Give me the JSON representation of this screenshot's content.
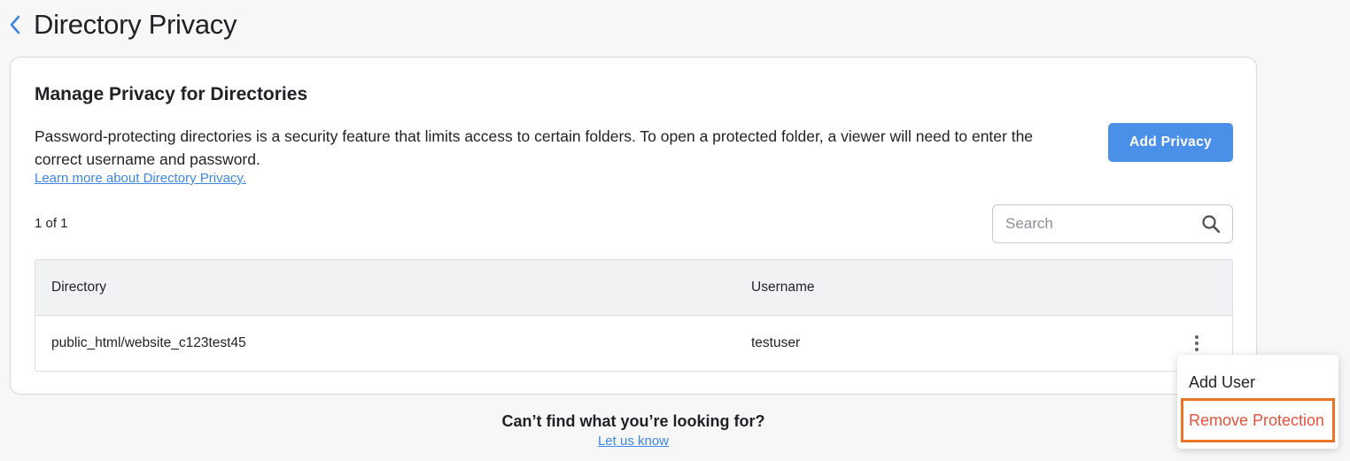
{
  "header": {
    "back_icon": "chevron-left-icon",
    "title": "Directory Privacy"
  },
  "card": {
    "title": "Manage Privacy for Directories",
    "description": "Password-protecting directories is a security feature that limits access to certain folders. To open a protected folder, a viewer will need to enter the correct username and password.",
    "learn_more": "Learn more about Directory Privacy.",
    "add_button": "Add Privacy",
    "pager": "1 of 1",
    "search": {
      "placeholder": "Search",
      "value": "",
      "icon": "search-icon"
    }
  },
  "table": {
    "columns": [
      "Directory",
      "Username"
    ],
    "rows": [
      {
        "directory": "public_html/website_c123test45",
        "username": "testuser"
      }
    ]
  },
  "row_menu": {
    "items": [
      {
        "label": "Add User"
      },
      {
        "label": "Remove Protection",
        "highlighted": true
      }
    ]
  },
  "footer": {
    "question": "Can’t find what you’re looking for?",
    "link": "Let us know"
  },
  "colors": {
    "accent": "#4a8fe8",
    "link": "#3c86e6",
    "danger_text": "#e5533b",
    "highlight_border": "#ea7326"
  }
}
